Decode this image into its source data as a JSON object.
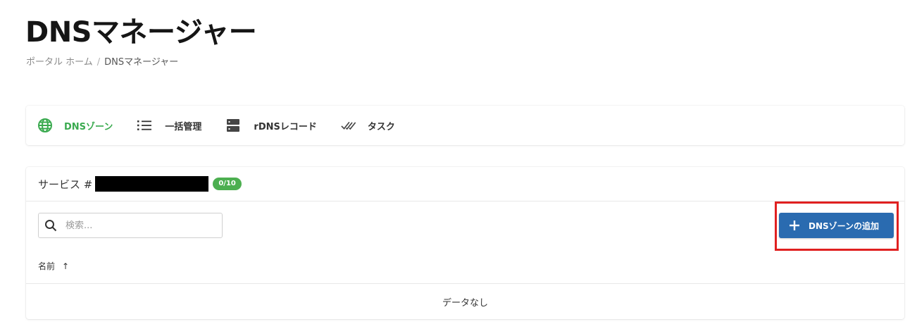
{
  "page": {
    "title": "DNSマネージャー",
    "breadcrumb": {
      "home": "ポータル ホーム",
      "separator": "/",
      "current": "DNSマネージャー"
    }
  },
  "tabs": [
    {
      "label": "DNSゾーン",
      "icon": "globe-icon",
      "active": true
    },
    {
      "label": "一括管理",
      "icon": "list-icon",
      "active": false
    },
    {
      "label": "rDNSレコード",
      "icon": "server-icon",
      "active": false
    },
    {
      "label": "タスク",
      "icon": "double-check-icon",
      "active": false
    }
  ],
  "service": {
    "title": "サービス #",
    "count_badge": "0/10",
    "search_placeholder": "検索...",
    "add_button_label": "DNSゾーンの追加",
    "column_name": "名前",
    "sort_indicator": "↑",
    "empty_message": "データなし"
  },
  "colors": {
    "active_tab": "#3aaa4f",
    "primary_button": "#2a6bb0",
    "badge": "#4caf50",
    "highlight_border": "#e02020"
  }
}
